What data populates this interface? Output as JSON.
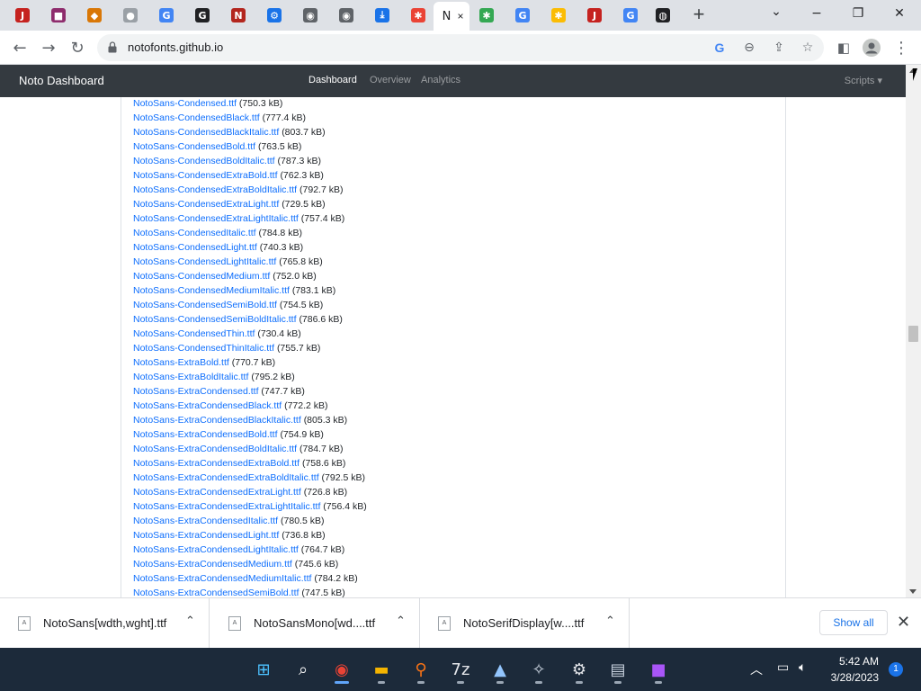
{
  "browser": {
    "active_tab_letter": "N",
    "tab_close": "×",
    "new_tab": "+",
    "tabs": [
      {
        "icon": "tab-icon-red-j",
        "color": "#c5221f",
        "glyph": "J"
      },
      {
        "icon": "tab-icon-winrar",
        "color": "#8e2c6d",
        "glyph": "■"
      },
      {
        "icon": "tab-icon-shield",
        "color": "#d97706",
        "glyph": "◆"
      },
      {
        "icon": "tab-icon-github",
        "color": "#9aa0a6",
        "glyph": "●"
      },
      {
        "icon": "tab-icon-google",
        "color": "#4285f4",
        "glyph": "G"
      },
      {
        "icon": "tab-icon-g-black",
        "color": "#202124",
        "glyph": "G"
      },
      {
        "icon": "tab-icon-noto-red",
        "color": "#b3261e",
        "glyph": "N"
      },
      {
        "icon": "tab-icon-settings",
        "color": "#1a73e8",
        "glyph": "⚙"
      },
      {
        "icon": "tab-icon-chromium",
        "color": "#5f6368",
        "glyph": "◉"
      },
      {
        "icon": "tab-icon-chromium-2",
        "color": "#5f6368",
        "glyph": "◉"
      },
      {
        "icon": "tab-icon-download",
        "color": "#1a73e8",
        "glyph": "⤓"
      },
      {
        "icon": "tab-icon-colorful",
        "color": "#ea4335",
        "glyph": "✱"
      },
      {
        "icon": "tab-icon-colorful-2",
        "color": "#34a853",
        "glyph": "✱"
      },
      {
        "icon": "tab-icon-google-2",
        "color": "#4285f4",
        "glyph": "G"
      },
      {
        "icon": "tab-icon-colorful-3",
        "color": "#fbbc04",
        "glyph": "✱"
      },
      {
        "icon": "tab-icon-red-j-2",
        "color": "#c5221f",
        "glyph": "J"
      },
      {
        "icon": "tab-icon-google-3",
        "color": "#4285f4",
        "glyph": "G"
      },
      {
        "icon": "tab-icon-globe",
        "color": "#202124",
        "glyph": "◍"
      }
    ],
    "url": "notofonts.github.io",
    "window_controls": {
      "minimize": "−",
      "restore": "❐",
      "close": "✕"
    }
  },
  "site": {
    "brand": "Noto Dashboard",
    "nav": [
      {
        "label": "Dashboard",
        "active": true
      },
      {
        "label": "Overview",
        "active": false
      },
      {
        "label": "Analytics",
        "active": false
      }
    ],
    "scripts_menu": "Scripts ▾"
  },
  "files": [
    {
      "name": "NotoSans-Condensed.ttf",
      "size": "(750.3 kB)"
    },
    {
      "name": "NotoSans-CondensedBlack.ttf",
      "size": "(777.4 kB)"
    },
    {
      "name": "NotoSans-CondensedBlackItalic.ttf",
      "size": "(803.7 kB)"
    },
    {
      "name": "NotoSans-CondensedBold.ttf",
      "size": "(763.5 kB)"
    },
    {
      "name": "NotoSans-CondensedBoldItalic.ttf",
      "size": "(787.3 kB)"
    },
    {
      "name": "NotoSans-CondensedExtraBold.ttf",
      "size": "(762.3 kB)"
    },
    {
      "name": "NotoSans-CondensedExtraBoldItalic.ttf",
      "size": "(792.7 kB)"
    },
    {
      "name": "NotoSans-CondensedExtraLight.ttf",
      "size": "(729.5 kB)"
    },
    {
      "name": "NotoSans-CondensedExtraLightItalic.ttf",
      "size": "(757.4 kB)"
    },
    {
      "name": "NotoSans-CondensedItalic.ttf",
      "size": "(784.8 kB)"
    },
    {
      "name": "NotoSans-CondensedLight.ttf",
      "size": "(740.3 kB)"
    },
    {
      "name": "NotoSans-CondensedLightItalic.ttf",
      "size": "(765.8 kB)"
    },
    {
      "name": "NotoSans-CondensedMedium.ttf",
      "size": "(752.0 kB)"
    },
    {
      "name": "NotoSans-CondensedMediumItalic.ttf",
      "size": "(783.1 kB)"
    },
    {
      "name": "NotoSans-CondensedSemiBold.ttf",
      "size": "(754.5 kB)"
    },
    {
      "name": "NotoSans-CondensedSemiBoldItalic.ttf",
      "size": "(786.6 kB)"
    },
    {
      "name": "NotoSans-CondensedThin.ttf",
      "size": "(730.4 kB)"
    },
    {
      "name": "NotoSans-CondensedThinItalic.ttf",
      "size": "(755.7 kB)"
    },
    {
      "name": "NotoSans-ExtraBold.ttf",
      "size": "(770.7 kB)"
    },
    {
      "name": "NotoSans-ExtraBoldItalic.ttf",
      "size": "(795.2 kB)"
    },
    {
      "name": "NotoSans-ExtraCondensed.ttf",
      "size": "(747.7 kB)"
    },
    {
      "name": "NotoSans-ExtraCondensedBlack.ttf",
      "size": "(772.2 kB)"
    },
    {
      "name": "NotoSans-ExtraCondensedBlackItalic.ttf",
      "size": "(805.3 kB)"
    },
    {
      "name": "NotoSans-ExtraCondensedBold.ttf",
      "size": "(754.9 kB)"
    },
    {
      "name": "NotoSans-ExtraCondensedBoldItalic.ttf",
      "size": "(784.7 kB)"
    },
    {
      "name": "NotoSans-ExtraCondensedExtraBold.ttf",
      "size": "(758.6 kB)"
    },
    {
      "name": "NotoSans-ExtraCondensedExtraBoldItalic.ttf",
      "size": "(792.5 kB)"
    },
    {
      "name": "NotoSans-ExtraCondensedExtraLight.ttf",
      "size": "(726.8 kB)"
    },
    {
      "name": "NotoSans-ExtraCondensedExtraLightItalic.ttf",
      "size": "(756.4 kB)"
    },
    {
      "name": "NotoSans-ExtraCondensedItalic.ttf",
      "size": "(780.5 kB)"
    },
    {
      "name": "NotoSans-ExtraCondensedLight.ttf",
      "size": "(736.8 kB)"
    },
    {
      "name": "NotoSans-ExtraCondensedLightItalic.ttf",
      "size": "(764.7 kB)"
    },
    {
      "name": "NotoSans-ExtraCondensedMedium.ttf",
      "size": "(745.6 kB)"
    },
    {
      "name": "NotoSans-ExtraCondensedMediumItalic.ttf",
      "size": "(784.2 kB)"
    },
    {
      "name": "NotoSans-ExtraCondensedSemiBold.ttf",
      "size": "(747.5 kB)"
    }
  ],
  "downloads": {
    "items": [
      {
        "name": "NotoSans[wdth,wght].ttf"
      },
      {
        "name": "NotoSansMono[wd....ttf"
      },
      {
        "name": "NotoSerifDisplay[w....ttf"
      }
    ],
    "show_all": "Show all",
    "close": "✕"
  },
  "taskbar": {
    "apps": [
      {
        "icon": "windows-start-icon",
        "glyph": "⊞",
        "color": "#4cc2ff"
      },
      {
        "icon": "search-icon",
        "glyph": "⌕",
        "color": "#ffffff"
      },
      {
        "icon": "chrome-icon",
        "glyph": "◉",
        "color": "#ea4335"
      },
      {
        "icon": "file-explorer-icon",
        "glyph": "▬",
        "color": "#f4b400"
      },
      {
        "icon": "magnifier-app-icon",
        "glyph": "⚲",
        "color": "#f97316"
      },
      {
        "icon": "7zip-icon",
        "glyph": "7z",
        "color": "#e5e7eb"
      },
      {
        "icon": "inkscape-icon",
        "glyph": "▲",
        "color": "#93c5fd"
      },
      {
        "icon": "fontforge-icon",
        "glyph": "✧",
        "color": "#cbd5e1"
      },
      {
        "icon": "settings-icon",
        "glyph": "⚙",
        "color": "#e5e7eb"
      },
      {
        "icon": "notepad-icon",
        "glyph": "▤",
        "color": "#cbd5e1"
      },
      {
        "icon": "winrar-icon",
        "glyph": "■",
        "color": "#a855f7"
      }
    ],
    "tray_up": "︿",
    "tray_network": "▭",
    "tray_volume": "🔈︎",
    "time": "5:42 AM",
    "date": "3/28/2023",
    "notification_count": "1"
  }
}
